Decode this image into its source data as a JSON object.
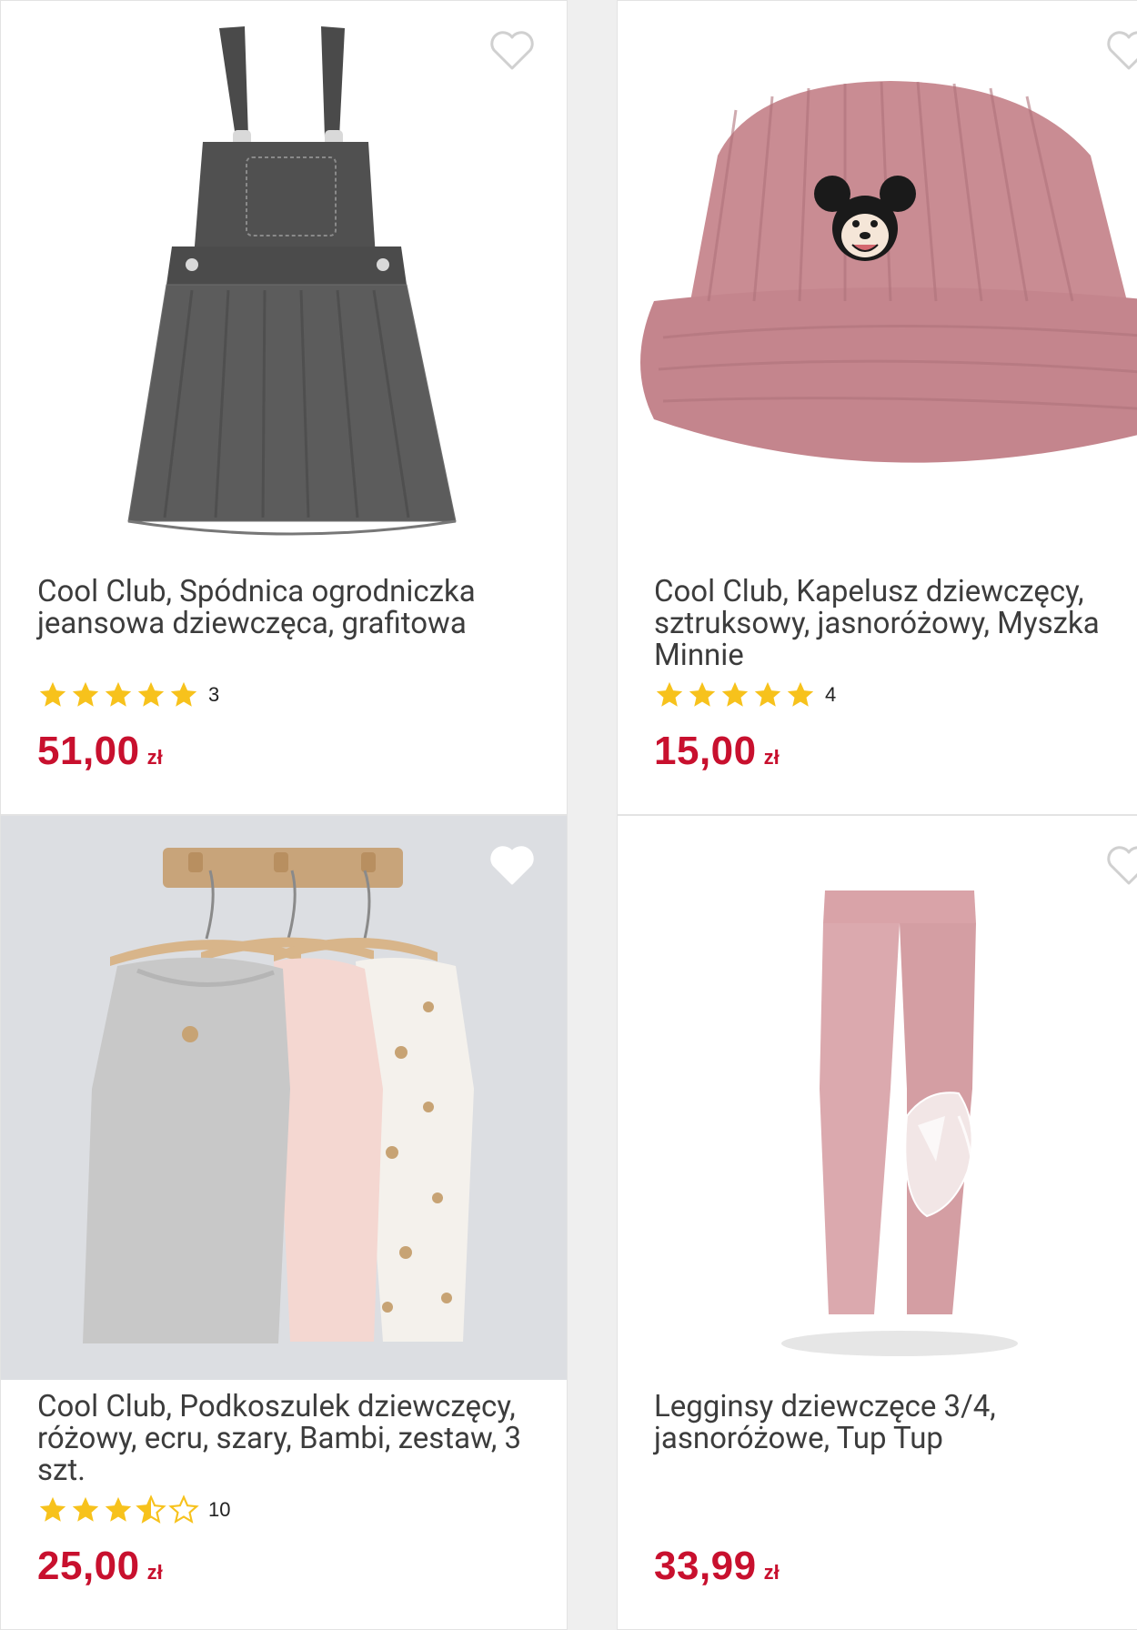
{
  "colors": {
    "price": "#c8102e",
    "star_filled": "#f7c21c",
    "star_empty_stroke": "#f7c21c",
    "heart_outline": "#d0d0d0",
    "heart_filled": "#ffffff"
  },
  "products": [
    {
      "title": "Cool Club, Spódnica ogrodniczka jeansowa dziewczęca, grafitowa",
      "rating": 5,
      "rating_count": "3",
      "price": "51,00",
      "currency": "zł",
      "favorite_icon": "heart-outline-icon",
      "image": "denim-pinafore-skirt"
    },
    {
      "title": "Cool Club, Kapelusz dziewczęcy, sztruksowy, jasnoróżowy, Myszka Minnie",
      "rating": 5,
      "rating_count": "4",
      "price": "15,00",
      "currency": "zł",
      "favorite_icon": "heart-outline-icon",
      "image": "pink-corduroy-bucket-hat"
    },
    {
      "title": "Cool Club, Podkoszulek dziewczęcy, różowy, ecru, szary, Bambi, zestaw, 3 szt.",
      "rating": 3.5,
      "rating_count": "10",
      "price": "25,00",
      "currency": "zł",
      "favorite_icon": "heart-filled-icon",
      "image": "three-tank-tops-on-hangers"
    },
    {
      "title": "Legginsy dziewczęce 3/4, jasnoróżowe, Tup Tup",
      "rating": null,
      "rating_count": "",
      "price": "33,99",
      "currency": "zł",
      "favorite_icon": "heart-outline-icon",
      "image": "pink-leggings"
    }
  ]
}
